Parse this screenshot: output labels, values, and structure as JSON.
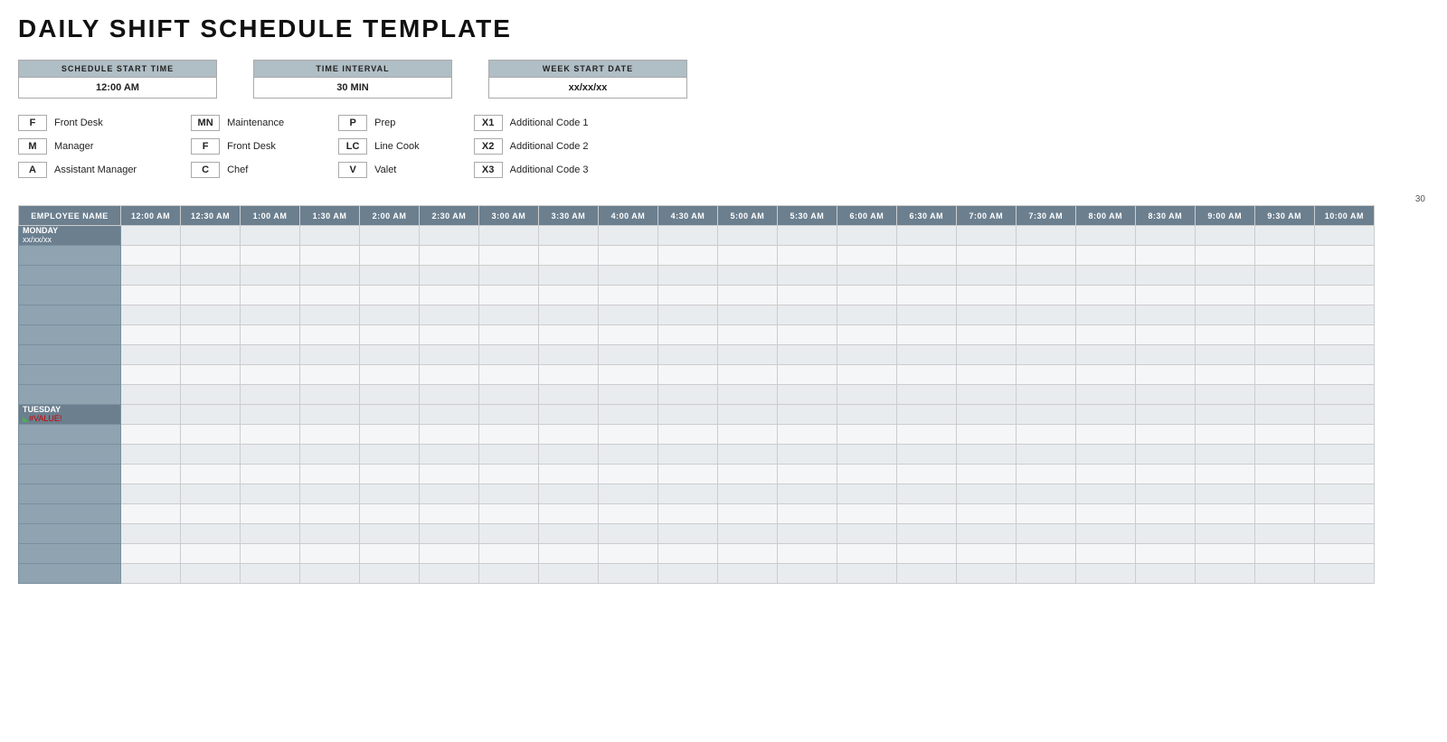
{
  "title": "DAILY SHIFT SCHEDULE TEMPLATE",
  "schedule_start_time": {
    "label": "SCHEDULE START TIME",
    "value": "12:00 AM"
  },
  "time_interval": {
    "label": "TIME INTERVAL",
    "value": "30 MIN"
  },
  "week_start_date": {
    "label": "WEEK START DATE",
    "value": "xx/xx/xx"
  },
  "scroll_number": "30",
  "legend": [
    {
      "col": 0,
      "code": "F",
      "desc": "Front Desk"
    },
    {
      "col": 0,
      "code": "M",
      "desc": "Manager"
    },
    {
      "col": 0,
      "code": "A",
      "desc": "Assistant Manager"
    },
    {
      "col": 1,
      "code": "MN",
      "desc": "Maintenance"
    },
    {
      "col": 1,
      "code": "F",
      "desc": "Front Desk"
    },
    {
      "col": 1,
      "code": "C",
      "desc": "Chef"
    },
    {
      "col": 2,
      "code": "P",
      "desc": "Prep"
    },
    {
      "col": 2,
      "code": "LC",
      "desc": "Line Cook"
    },
    {
      "col": 2,
      "code": "V",
      "desc": "Valet"
    },
    {
      "col": 3,
      "code": "X1",
      "desc": "Additional Code 1"
    },
    {
      "col": 3,
      "code": "X2",
      "desc": "Additional Code 2"
    },
    {
      "col": 3,
      "code": "X3",
      "desc": "Additional Code 3"
    }
  ],
  "employee_name_label": "EMPLOYEE NAME",
  "time_slots": [
    "12:00 AM",
    "12:30 AM",
    "1:00 AM",
    "1:30 AM",
    "2:00 AM",
    "2:30 AM",
    "3:00 AM",
    "3:30 AM",
    "4:00 AM",
    "4:30 AM",
    "5:00 AM",
    "5:30 AM",
    "6:00 AM",
    "6:30 AM",
    "7:00 AM",
    "7:30 AM",
    "8:00 AM",
    "8:30 AM",
    "9:00 AM",
    "9:30 AM",
    "10:00 AM"
  ],
  "days": [
    {
      "name": "MONDAY",
      "date": "xx/xx/xx",
      "rows": 9
    },
    {
      "name": "TUESDAY",
      "date": "#VALUE!",
      "rows": 9,
      "value_error": true
    }
  ]
}
